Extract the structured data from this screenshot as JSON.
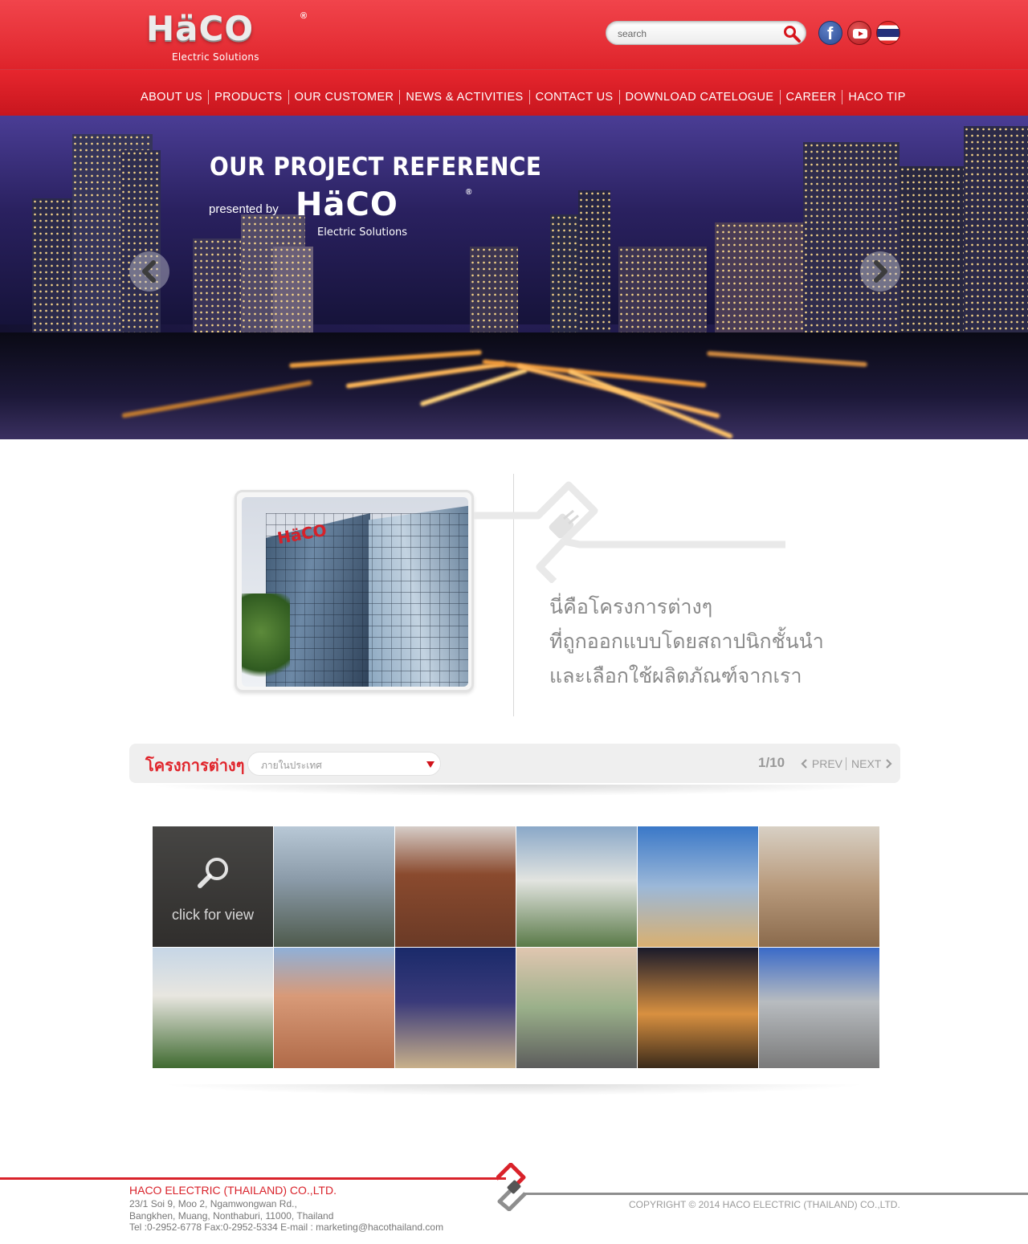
{
  "brand": {
    "logo_text": "HäCO",
    "registered": "®",
    "tagline": "Electric Solutions",
    "primary_color": "#e0252c"
  },
  "search": {
    "placeholder": "search"
  },
  "social": {
    "facebook_glyph": "f",
    "icons": [
      "facebook-icon",
      "youtube-icon",
      "thai-flag-icon"
    ]
  },
  "nav": {
    "items": [
      {
        "label": "ABOUT US"
      },
      {
        "label": "PRODUCTS"
      },
      {
        "label": "OUR CUSTOMER"
      },
      {
        "label": "NEWS & ACTIVITIES"
      },
      {
        "label": "CONTACT US"
      },
      {
        "label": "DOWNLOAD CATELOGUE"
      },
      {
        "label": "CAREER"
      },
      {
        "label": "HACO TIP"
      }
    ]
  },
  "hero": {
    "title": "OUR PROJECT REFERENCE",
    "presented_by": "presented by",
    "logo_text": "HäCO",
    "registered": "®",
    "logo_sub": "Electric Solutions"
  },
  "intro": {
    "lines": [
      "นี่คือโครงการต่างๆ",
      "ที่ถูกออกแบบโดยสถาปนิกชั้นนำ",
      "และเลือกใช้ผลิตภัณฑ์จากเรา"
    ],
    "building_sign": "HäCO"
  },
  "projects": {
    "title": "โครงการต่างๆ",
    "filter_selected": "ภายในประเทศ",
    "page_indicator": "1/10",
    "prev_label": "PREV",
    "next_label": "NEXT",
    "thumbnail_overlay_label": "click for view",
    "thumbnail_count": 12
  },
  "footer": {
    "company": "HACO ELECTRIC (THAILAND) CO.,LTD.",
    "address_line1": "23/1 Soi 9, Moo 2, Ngamwongwan Rd.,",
    "address_line2": "Bangkhen, Muang, Nonthaburi, 11000, Thailand",
    "contact": "Tel :0-2952-6778 Fax:0-2952-5334 E-mail : marketing@hacothailand.com",
    "copyright": "COPYRIGHT © 2014 HACO ELECTRIC (THAILAND) CO.,LTD."
  }
}
